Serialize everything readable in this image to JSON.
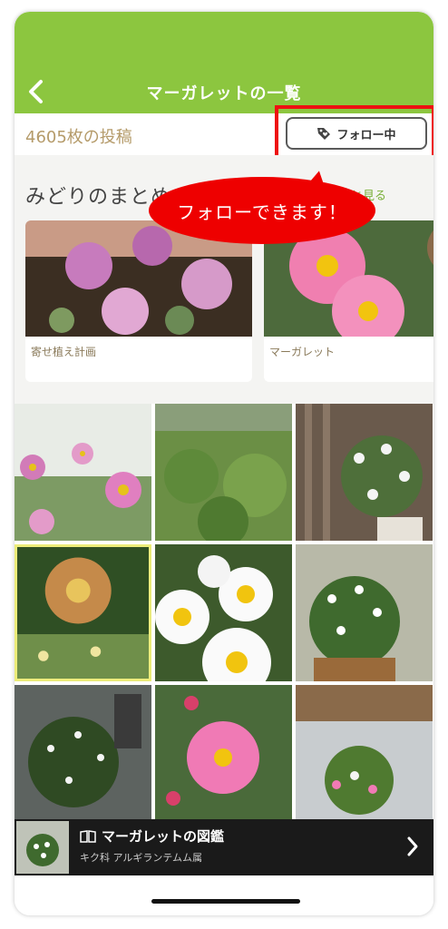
{
  "header": {
    "title": "マーガレットの一覧",
    "back_icon": "chevron-left-icon",
    "background_color": "#8cc63f"
  },
  "stats": {
    "post_count": "4605枚の投稿",
    "follow_button_label": "フォロー中",
    "follow_icon": "tag-icon"
  },
  "annotation": {
    "bubble_text": "フォローできます！",
    "highlight_color": "#ee1111"
  },
  "collections": {
    "title": "みどりのまとめ",
    "more_label": "もっと見る",
    "cards": [
      {
        "caption": "寄せ植え計画"
      },
      {
        "caption": "マーガレット"
      }
    ]
  },
  "guide": {
    "title": "マーガレットの図鑑",
    "subtitle": "キク科 アルギランテムム属",
    "book_icon": "book-icon",
    "arrow_icon": "chevron-right-icon"
  }
}
